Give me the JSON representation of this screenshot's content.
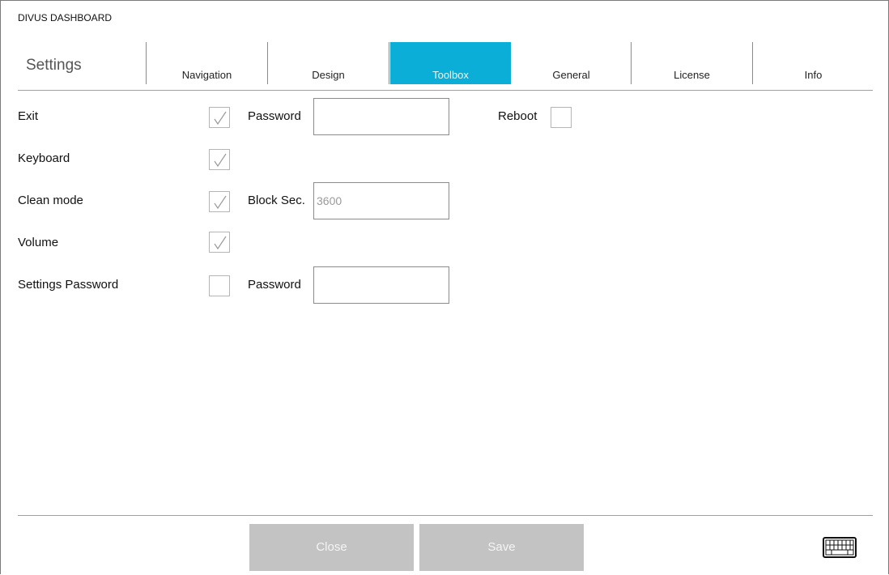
{
  "window": {
    "title": "DIVUS DASHBOARD"
  },
  "header": {
    "title": "Settings",
    "tabs": [
      {
        "label": "Navigation",
        "active": false
      },
      {
        "label": "Design",
        "active": false
      },
      {
        "label": "Toolbox",
        "active": true
      },
      {
        "label": "General",
        "active": false
      },
      {
        "label": "License",
        "active": false
      },
      {
        "label": "Info",
        "active": false
      }
    ]
  },
  "toolbox": {
    "exit": {
      "label": "Exit",
      "checked": true,
      "password_label": "Password",
      "password_value": ""
    },
    "reboot": {
      "label": "Reboot",
      "checked": false
    },
    "keyboard": {
      "label": "Keyboard",
      "checked": true
    },
    "clean_mode": {
      "label": "Clean mode",
      "checked": true,
      "block_label": "Block Sec.",
      "block_value": "3600"
    },
    "volume": {
      "label": "Volume",
      "checked": true
    },
    "settings_password": {
      "label": "Settings Password",
      "checked": false,
      "password_label": "Password",
      "password_value": ""
    }
  },
  "footer": {
    "close_label": "Close",
    "save_label": "Save",
    "keyboard_icon": "keyboard-icon"
  },
  "colors": {
    "accent": "#0aaed6",
    "button_disabled": "#c3c3c3"
  }
}
